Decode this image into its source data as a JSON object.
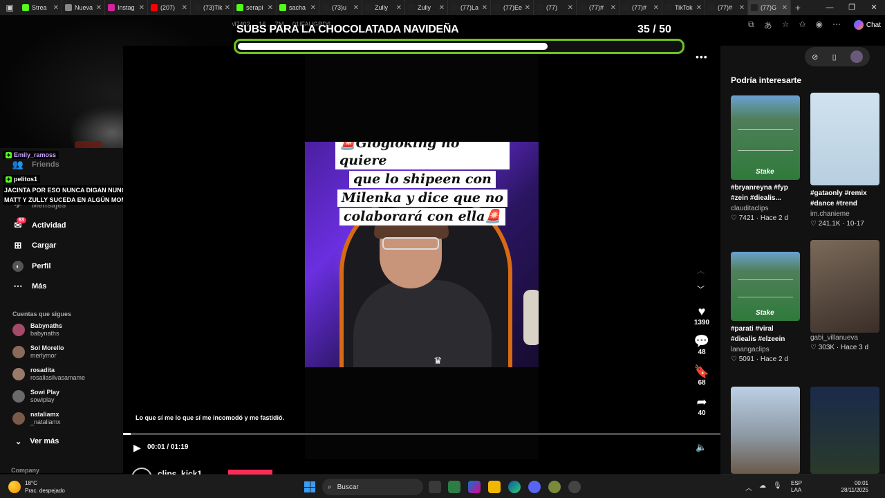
{
  "browser": {
    "tabs": [
      {
        "label": "Strea",
        "fav": "#53fc18"
      },
      {
        "label": "Nueva",
        "fav": "#888888"
      },
      {
        "label": "Instag",
        "fav": "#d6249f"
      },
      {
        "label": "(207)",
        "fav": "#ff0000"
      },
      {
        "label": "(73)Tik",
        "fav": "#222222"
      },
      {
        "label": "serapi",
        "fav": "#53fc18"
      },
      {
        "label": "sacha",
        "fav": "#53fc18"
      },
      {
        "label": "(73)u",
        "fav": "#222222"
      },
      {
        "label": "Zully",
        "fav": "#222222"
      },
      {
        "label": "Zully",
        "fav": "#222222"
      },
      {
        "label": "(77)La",
        "fav": "#222222"
      },
      {
        "label": "(77)Ee",
        "fav": "#222222"
      },
      {
        "label": "(77)",
        "fav": "#222222"
      },
      {
        "label": "(77)#",
        "fav": "#222222"
      },
      {
        "label": "(77)#",
        "fav": "#222222"
      },
      {
        "label": "TikTok",
        "fav": "#222222"
      },
      {
        "label": "(77)#",
        "fav": "#222222"
      },
      {
        "label": "(77)G",
        "fav": "#222222"
      }
    ],
    "active_tab_index": 17,
    "url_fragment": "M7402 ... 1& ... ZM ... 01IFAUGRD6",
    "chat_label": "Chat"
  },
  "goal": {
    "title": "SUBS PARA LA CHOCOLATADA NAVIDEÑA",
    "count": "35  / 50",
    "progress": 0.7
  },
  "sidebar": {
    "nav": [
      {
        "label": "Friends",
        "icon": "friends-icon",
        "dim": true
      },
      {
        "label": "Mensajes",
        "icon": "messages-icon",
        "dim": true
      },
      {
        "label": "Actividad",
        "icon": "activity-icon",
        "dim": false
      },
      {
        "label": "Cargar",
        "icon": "upload-icon",
        "dim": false
      },
      {
        "label": "Perfil",
        "icon": "profile-icon",
        "dim": false
      },
      {
        "label": "Más",
        "icon": "more-icon",
        "dim": false
      }
    ],
    "activity_badge": "63",
    "following_title": "Cuentas que sigues",
    "following": [
      {
        "name": "Babynaths",
        "user": "babynaths",
        "color": "#a44a6a"
      },
      {
        "name": "Sol Morello",
        "user": "merlymor",
        "color": "#8a6a5a"
      },
      {
        "name": "rosadita",
        "user": "rosaliasilvasamame",
        "color": "#9a7a6a"
      },
      {
        "name": "Sowi Play",
        "user": "sowiplay",
        "color": "#6a6a6a"
      },
      {
        "name": "nataliamx",
        "user": "_nataliamx",
        "color": "#7a5a4a"
      }
    ],
    "see_more": "Ver más",
    "company": "Company"
  },
  "chat": {
    "user1": "Emily_ramoss",
    "user2": "pelitos1",
    "message": "JACINTA POR ESO NUNCA DIGAN NUNCA TAL VEZ EL REENCUENTRO DE MATT Y ZULLY SUCEDA EN ALGÚN MOMENTO"
  },
  "video": {
    "caption_lines": [
      "🚨Glogloking no quiere",
      "que lo shipeen con",
      "Milenka y dice que no",
      "colaborará con ella🚨"
    ],
    "subtitle": "Lo que sí me lo que sí me incomodó y me fastidió.",
    "time": "00:01 / 01:19",
    "progress": 0.0127,
    "creator": "clips_kick1"
  },
  "actions": {
    "likes": "1390",
    "comments": "48",
    "saves": "68",
    "shares": "40"
  },
  "right_panel": {
    "title": "Podría interesarte",
    "cards": [
      {
        "tags": "#bryanreyna #fyp #zein #diealis...",
        "user": "clauditaclips",
        "stats": "♡ 7421 · Hace 2 d",
        "thumb": "pitch",
        "stake": true
      },
      {
        "tags": "#gataonly #remix #dance #trend",
        "user": "im.chanieme",
        "stats": "♡ 241.1K · 10-17",
        "thumb": "dance",
        "stake": false
      },
      {
        "tags": "#parati #viral #diealis #elzeein",
        "user": "lanangaclips",
        "stats": "♡ 5091 · Hace 2 d",
        "thumb": "pitch",
        "stake": true
      },
      {
        "tags": "",
        "user": "gabi_villanueva",
        "stats": "♡ 303K · Hace 3 d",
        "thumb": "couch",
        "stake": false
      },
      {
        "tags": "",
        "user": "",
        "stats": "",
        "thumb": "rooftop",
        "stake": false
      },
      {
        "tags": "",
        "user": "",
        "stats": "",
        "thumb": "rapper",
        "stake": false
      }
    ],
    "stake_label": "Stake"
  },
  "taskbar": {
    "temp": "18°C",
    "weather": "Prac. despejado",
    "search": "Buscar",
    "lang1": "ESP",
    "lang2": "LAA",
    "time": "00:01",
    "date": "28/11/2025"
  }
}
